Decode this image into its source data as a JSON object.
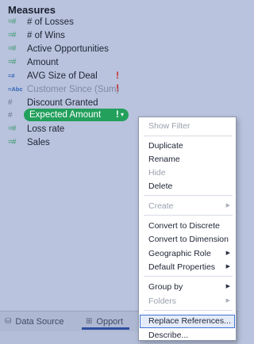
{
  "panel": {
    "title": "Measures"
  },
  "fields": [
    {
      "icon": "#",
      "name": "# of Losses"
    },
    {
      "icon": "#",
      "name": "# of Wins"
    },
    {
      "icon": "#",
      "name": "Active Opportunities"
    },
    {
      "icon": "#",
      "name": "Amount"
    },
    {
      "icon": "#",
      "name": "AVG Size of Deal"
    },
    {
      "icon": "Abc",
      "name": "Customer Since (Sum)"
    },
    {
      "icon": "#",
      "name": "Discount Granted"
    },
    {
      "icon": "#",
      "name": "Expected Amount"
    },
    {
      "icon": "#",
      "name": "Loss rate"
    },
    {
      "icon": "#",
      "name": "Sales"
    }
  ],
  "warning_mark": "!",
  "pill_arrow": "▾",
  "tabs": [
    {
      "label": "Data Source"
    },
    {
      "label": "Opport"
    }
  ],
  "menu": {
    "items": [
      {
        "label": "Show Filter",
        "disabled": true
      },
      {
        "label": "Duplicate"
      },
      {
        "label": "Rename"
      },
      {
        "label": "Hide",
        "disabled": true
      },
      {
        "label": "Delete"
      },
      {
        "label": "Create",
        "disabled": true,
        "submenu": true
      },
      {
        "label": "Convert to Discrete"
      },
      {
        "label": "Convert to Dimension"
      },
      {
        "label": "Geographic Role",
        "submenu": true
      },
      {
        "label": "Default Properties",
        "submenu": true
      },
      {
        "label": "Group by",
        "submenu": true
      },
      {
        "label": "Folders",
        "disabled": true,
        "submenu": true
      },
      {
        "label": "Replace References...",
        "highlighted": true
      },
      {
        "label": "Describe..."
      }
    ],
    "submenu_arrow": "▶"
  },
  "colors": {
    "background": "#b9c3dd",
    "selected_pill": "#23a05c",
    "warning": "#c9302c",
    "highlight_border": "#3f73d6"
  }
}
